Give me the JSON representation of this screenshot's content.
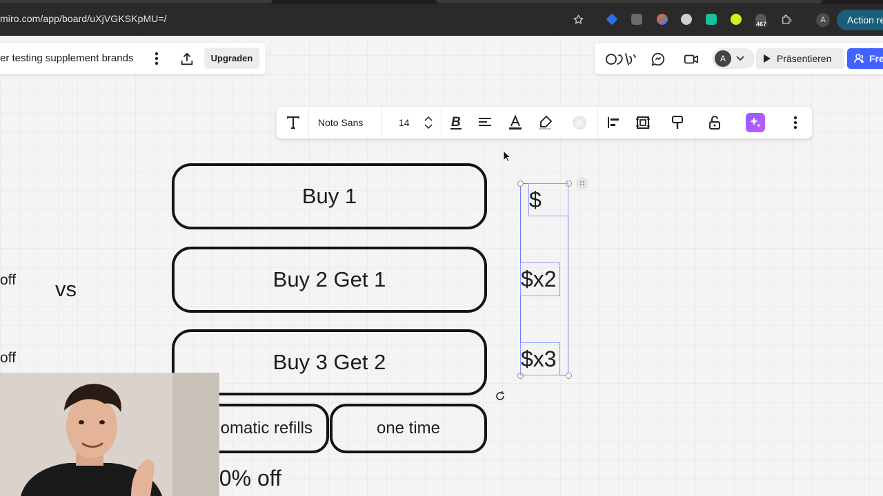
{
  "browser": {
    "url": "miro.com/app/board/uXjVGKSKpMU=/",
    "extension_badge": "467",
    "profile_initial": "A",
    "action_button_label": "Action re"
  },
  "board_header": {
    "title": "er testing supplement brands",
    "upgrade_label": "Upgraden"
  },
  "top_right": {
    "avatar_initial": "A",
    "present_label": "Präsentieren",
    "share_label": "Fre"
  },
  "text_toolbar": {
    "font_name": "Noto Sans",
    "font_size": "14"
  },
  "board": {
    "buy_1": "Buy 1",
    "buy_2_get_1": "Buy 2 Get 1",
    "buy_3_get_2": "Buy 3 Get 2",
    "auto_refills": "omatic refills",
    "one_time": "one time",
    "off_1": "off",
    "off_2": "off",
    "vs": "vs",
    "bottom_discount": "20% off",
    "price_1": "$",
    "price_2": "$x2",
    "price_3": "$x3"
  },
  "colors": {
    "accent": "#4262ff",
    "selection": "#6b7cff",
    "ai": "#a45cff"
  }
}
